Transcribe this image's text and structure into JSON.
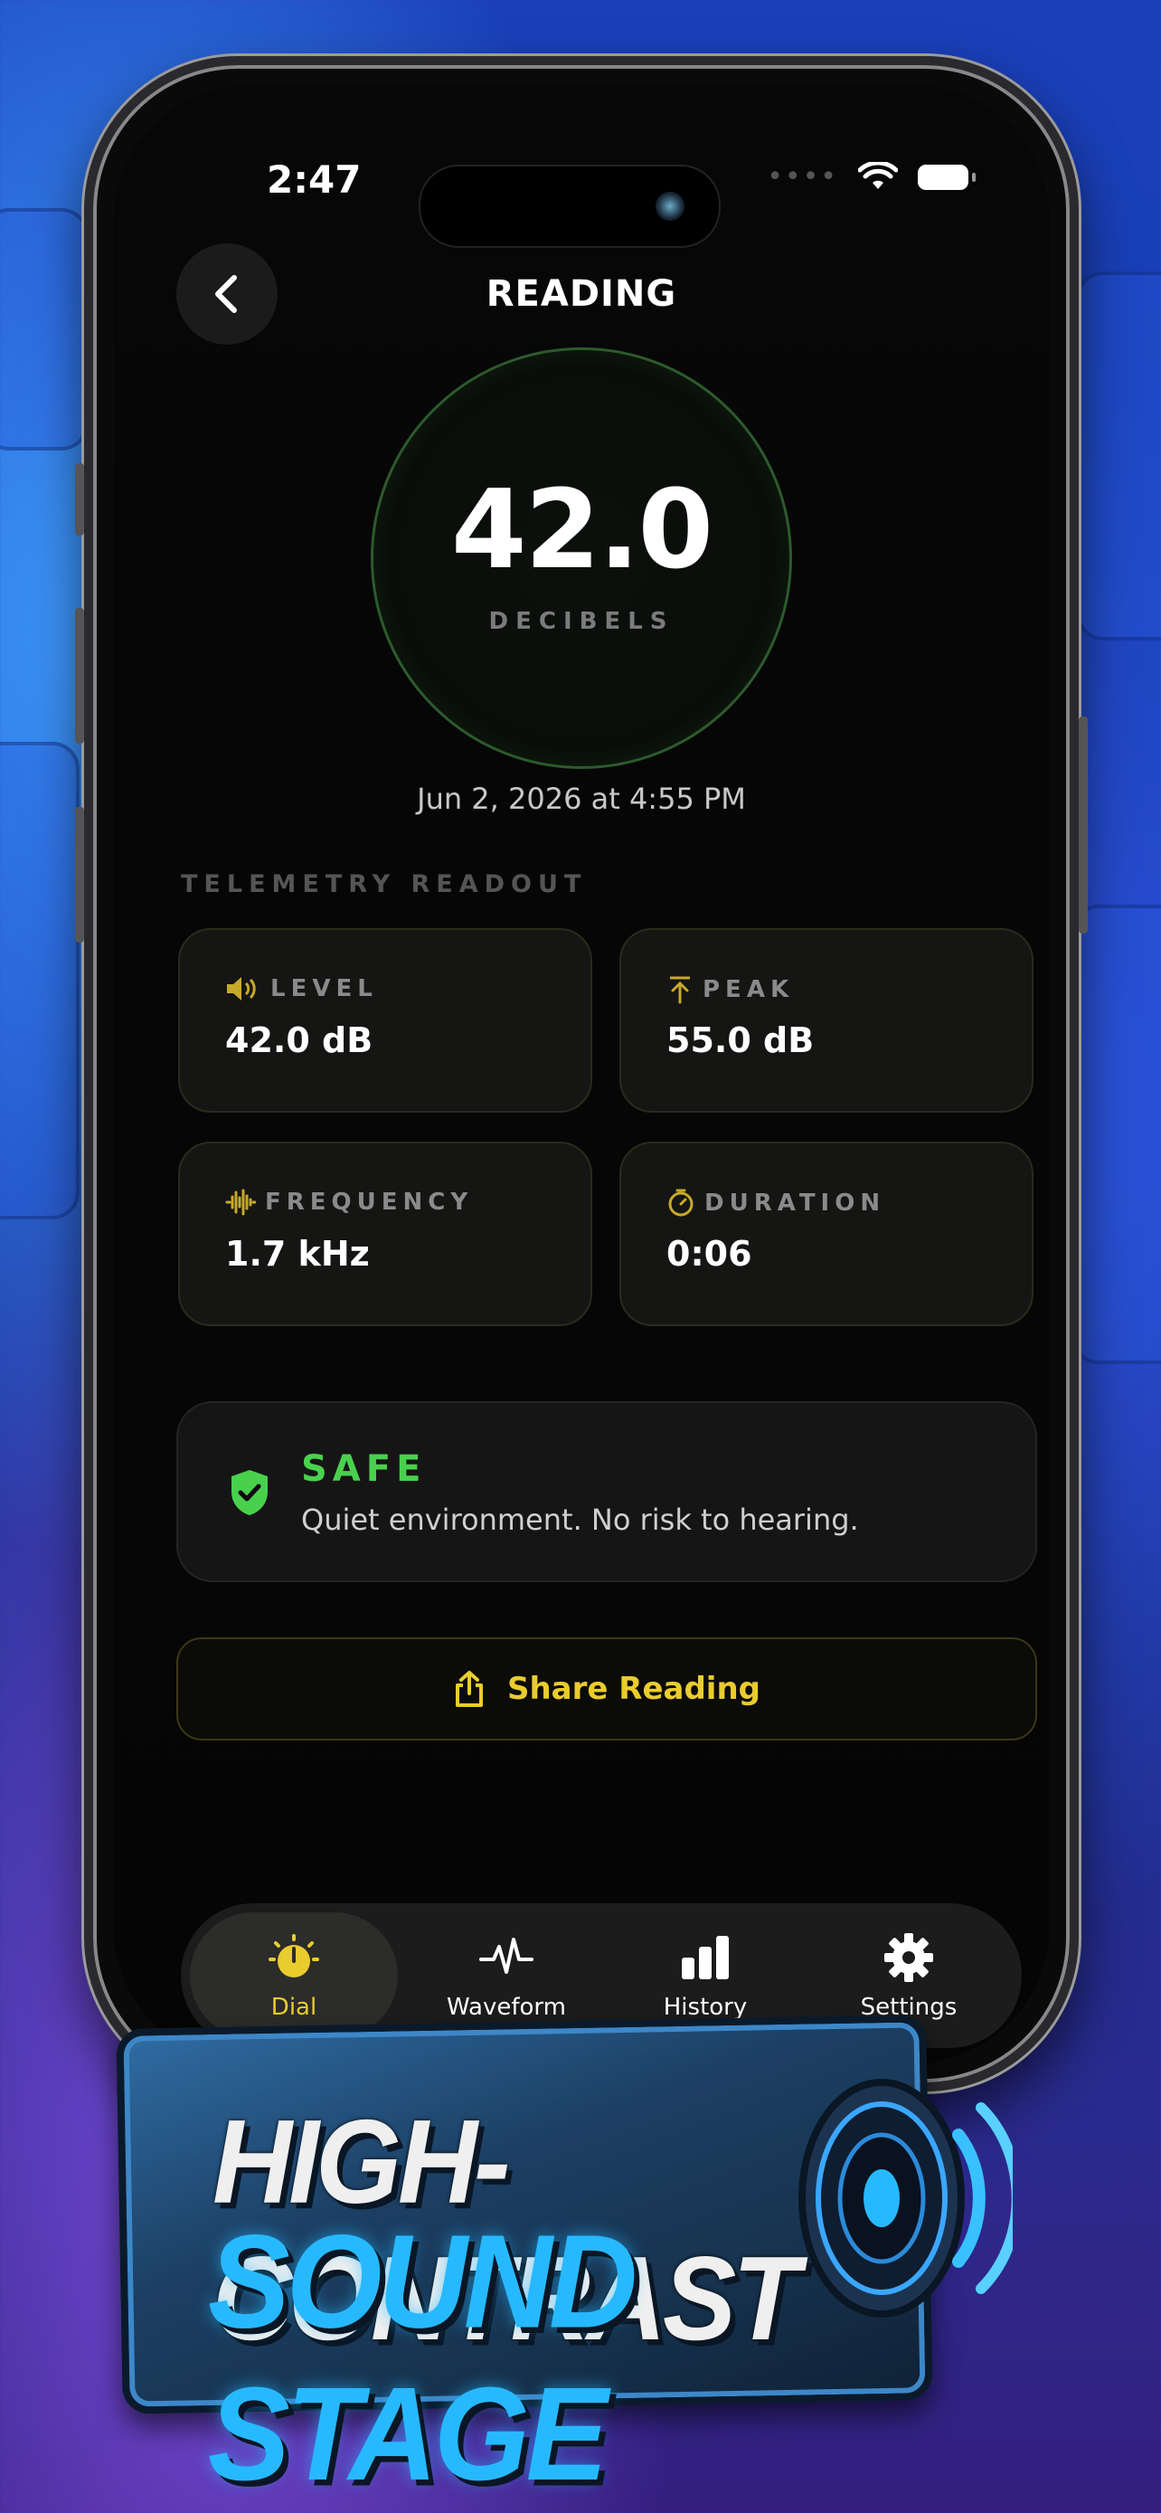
{
  "status": {
    "time": "2:47"
  },
  "header": {
    "title": "READING",
    "back_icon": "chevron-left-icon"
  },
  "dial": {
    "value": "42.0",
    "unit": "DECIBELS"
  },
  "timestamp": "Jun 2, 2026 at 4:55 PM",
  "telemetry": {
    "section_label": "TELEMETRY READOUT",
    "tiles": [
      {
        "label": "LEVEL",
        "value": "42.0 dB",
        "icon": "speaker-icon"
      },
      {
        "label": "PEAK",
        "value": "55.0 dB",
        "icon": "arrow-up-to-line-icon"
      },
      {
        "label": "FREQUENCY",
        "value": "1.7 kHz",
        "icon": "waveform-icon"
      },
      {
        "label": "DURATION",
        "value": "0:06",
        "icon": "timer-icon"
      }
    ]
  },
  "status_card": {
    "title": "SAFE",
    "description": "Quiet environment. No risk to hearing.",
    "color": "#49d14e"
  },
  "share": {
    "label": "Share Reading",
    "color": "#e9cc2e"
  },
  "tabs": [
    {
      "label": "Dial",
      "active": true
    },
    {
      "label": "Waveform",
      "active": false
    },
    {
      "label": "History",
      "active": false
    },
    {
      "label": "Settings",
      "active": false
    }
  ],
  "banner": {
    "line1": "HIGH-CONTRAST",
    "line2": "SOUND STAGE"
  }
}
